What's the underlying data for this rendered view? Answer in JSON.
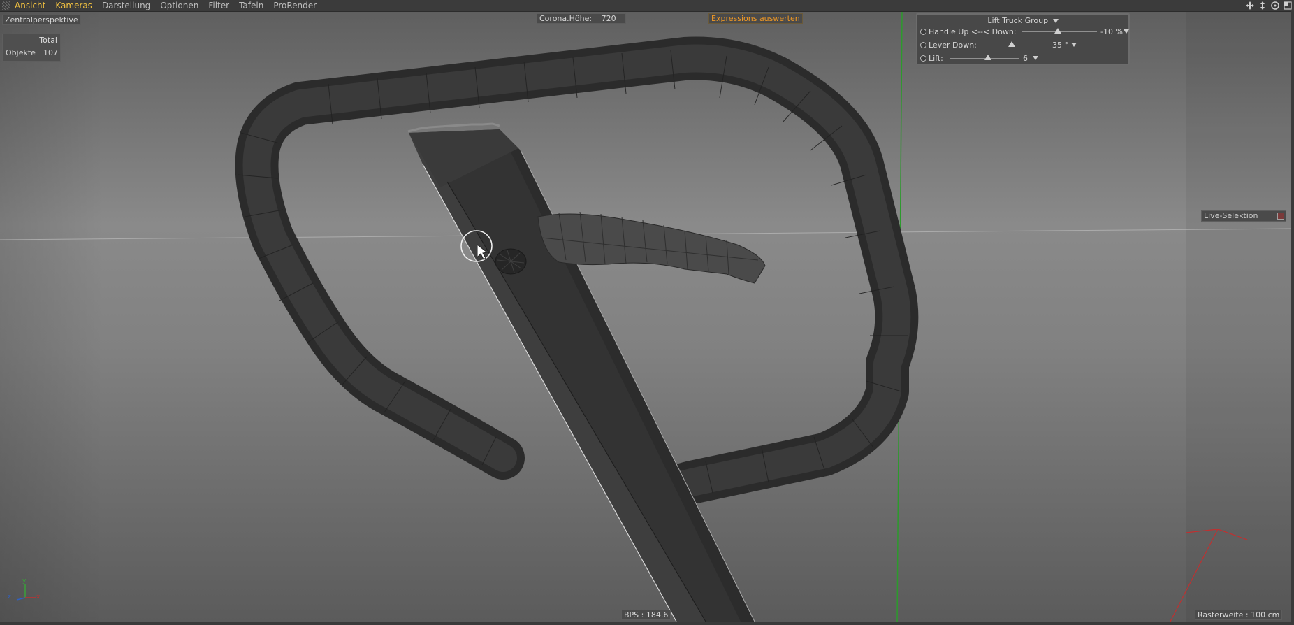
{
  "menu": {
    "items": [
      "Ansicht",
      "Kameras",
      "Darstellung",
      "Optionen",
      "Filter",
      "Tafeln",
      "ProRender"
    ],
    "active": [
      "Ansicht",
      "Kameras"
    ],
    "nav_icons": [
      "move-view-icon",
      "scale-view-icon",
      "rotate-view-icon",
      "maximize-view-icon"
    ]
  },
  "viewport": {
    "camera": "Zentralperspektive",
    "stats": {
      "header": "Total",
      "label": "Objekte",
      "value": "107"
    },
    "corona": {
      "label": "Corona.Höhe:",
      "value": "720"
    },
    "expressions_button": "Expressions auswerten",
    "tool_label": "Live-Selektion",
    "fps": "BPS : 184.6",
    "grid_size": "Rasterweite : 100 cm",
    "axis_letters": {
      "x": "x",
      "y": "y",
      "z": "z"
    }
  },
  "props_hud": {
    "title": "Lift Truck Group",
    "rows": [
      {
        "label": "Handle Up <--< Down:",
        "value": "-10 %",
        "slider": 0.47
      },
      {
        "label": "Lever Down:",
        "value": "35 °",
        "slider": 0.45
      },
      {
        "label": "Lift:",
        "value": "6",
        "slider": 0.55
      }
    ]
  },
  "colors": {
    "menu_active": "#f0c040",
    "expressions": "#f39a23",
    "y_axis_line": "#2c9a2c",
    "axis_gizmo_red": "#c03030"
  }
}
